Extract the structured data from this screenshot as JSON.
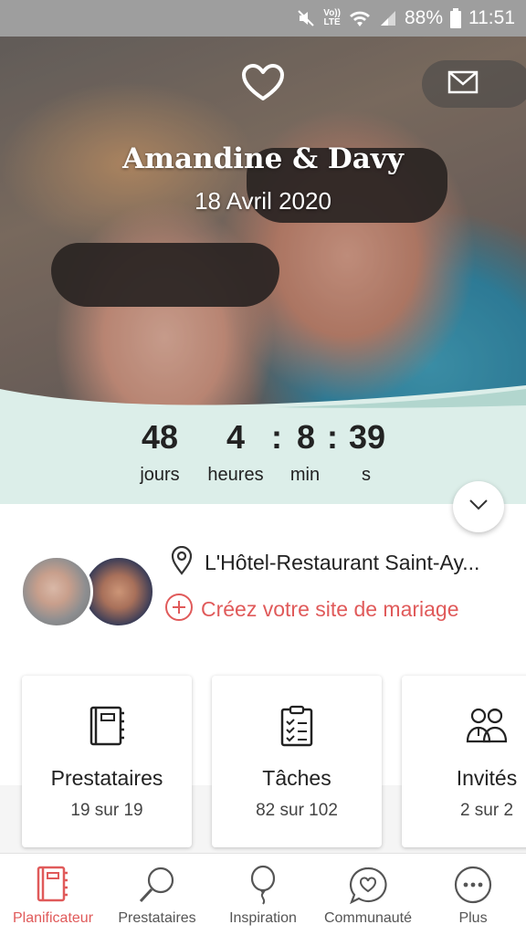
{
  "status_bar": {
    "volte_top": "Vo))",
    "volte_bottom": "LTE",
    "battery": "88%",
    "time": "11:51"
  },
  "hero": {
    "couple_name": "Amandine & Davy",
    "date": "18 Avril 2020"
  },
  "countdown": {
    "days": "48",
    "days_label": "jours",
    "hours": "4",
    "hours_label": "heures",
    "minutes": "8",
    "minutes_label": "min",
    "seconds": "39",
    "seconds_label": "s",
    "band_color": "#dceee9"
  },
  "info": {
    "venue": "L'Hôtel-Restaurant Saint-Ay...",
    "create_site": "Créez votre site de mariage"
  },
  "cards": [
    {
      "title": "Prestataires",
      "subtitle": "19 sur 19",
      "icon": "notebook-icon"
    },
    {
      "title": "Tâches",
      "subtitle": "82 sur 102",
      "icon": "clipboard-checklist-icon"
    },
    {
      "title": "Invités",
      "subtitle": "2 sur 2",
      "icon": "guests-icon"
    }
  ],
  "bottom_nav": [
    {
      "label": "Planificateur",
      "icon": "planner-notebook-icon",
      "active": true
    },
    {
      "label": "Prestataires",
      "icon": "search-icon",
      "active": false
    },
    {
      "label": "Inspiration",
      "icon": "balloon-icon",
      "active": false
    },
    {
      "label": "Communauté",
      "icon": "chat-heart-icon",
      "active": false
    },
    {
      "label": "Plus",
      "icon": "more-icon",
      "active": false
    }
  ],
  "colors": {
    "accent": "#e05a5a",
    "countdown_band": "#dceee9",
    "status_bar": "#9e9e9e"
  }
}
